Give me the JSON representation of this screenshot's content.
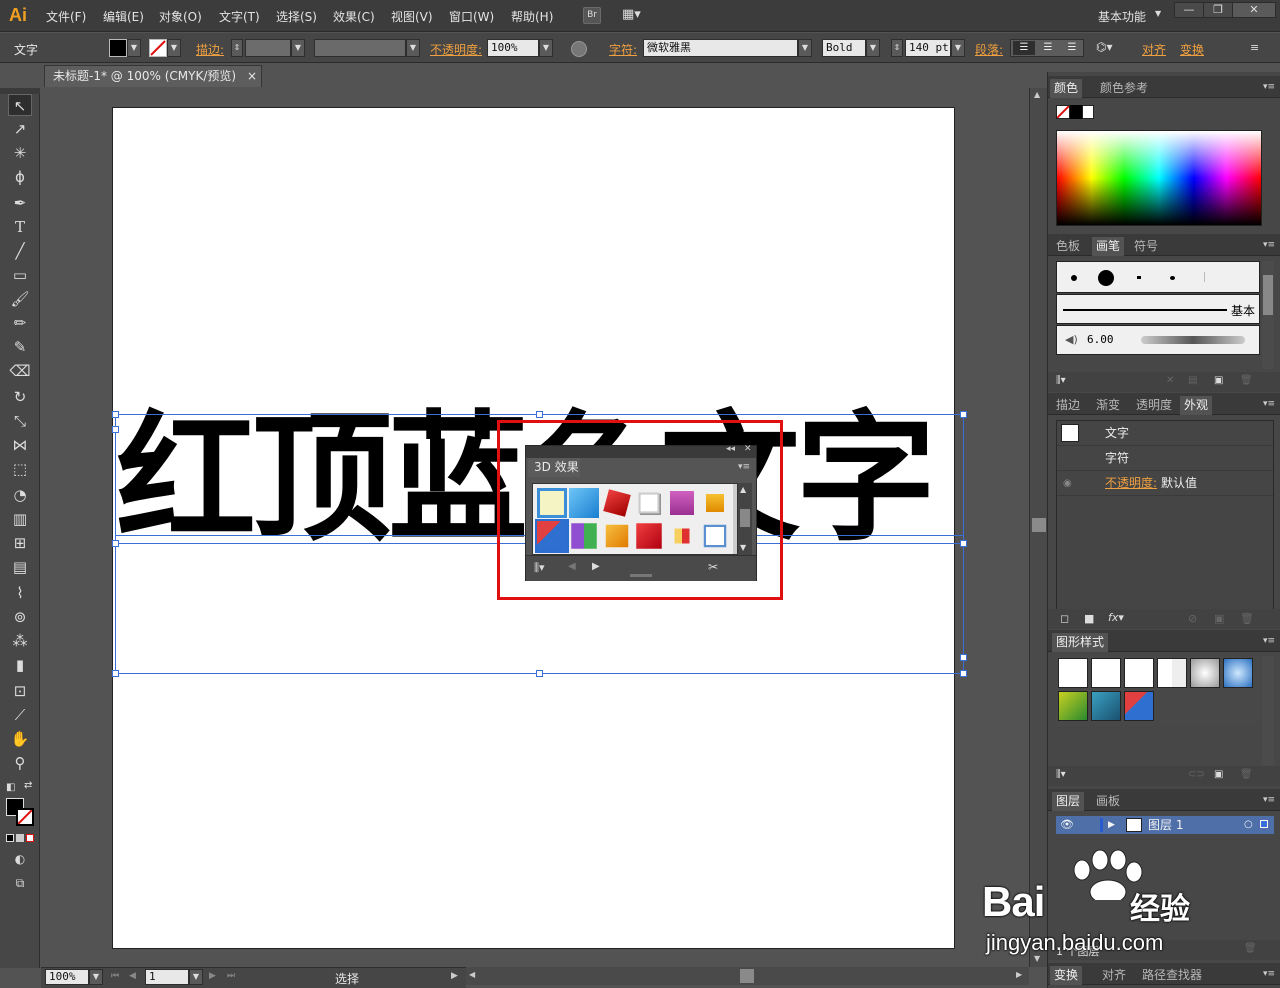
{
  "app": {
    "logo": "Ai",
    "workspace": "基本功能",
    "bridge_label": "Br"
  },
  "menu": [
    "文件(F)",
    "编辑(E)",
    "对象(O)",
    "文字(T)",
    "选择(S)",
    "效果(C)",
    "视图(V)",
    "窗口(W)",
    "帮助(H)"
  ],
  "control": {
    "selection_type": "文字",
    "stroke_label": "描边:",
    "opacity_label": "不透明度:",
    "opacity_value": "100%",
    "char_label": "字符:",
    "font_family": "微软雅黑",
    "font_style": "Bold",
    "font_size": "140 pt",
    "para_label": "段落:",
    "align_label": "对齐",
    "transform_label": "变换"
  },
  "document": {
    "tab_title": "未标题-1* @ 100% (CMYK/预览)",
    "close": "×"
  },
  "canvas": {
    "text": "红顶蓝色文字"
  },
  "panel3d": {
    "title": "3D 效果"
  },
  "status": {
    "zoom": "100%",
    "page": "1",
    "tool": "选择"
  },
  "color_panel": {
    "tabs": [
      "颜色",
      "颜色参考"
    ]
  },
  "brush_panel": {
    "tabs": [
      "色板",
      "画笔",
      "符号"
    ],
    "basic_label": "基本",
    "size_value": "6.00"
  },
  "appearance_panel": {
    "tabs": [
      "描边",
      "渐变",
      "透明度",
      "外观"
    ],
    "rows": [
      {
        "label": "文字"
      },
      {
        "label": "字符"
      },
      {
        "label": "不透明度:",
        "value": "默认值"
      }
    ]
  },
  "graphic_styles_panel": {
    "tabs": [
      "图形样式"
    ]
  },
  "layers_panel": {
    "tabs": [
      "图层",
      "画板"
    ],
    "layer_name": "图层 1",
    "count": "1 个图层"
  },
  "bottom_tabs": [
    "变换",
    "对齐",
    "路径查找器"
  ],
  "watermark": {
    "brand_latin": "Bai",
    "brand_cn": "经验",
    "url": "jingyan.baidu.com"
  },
  "colors": {
    "accent_red": "#e01010",
    "selection_blue": "#3b6fd8",
    "label_orange": "#f0a040"
  }
}
